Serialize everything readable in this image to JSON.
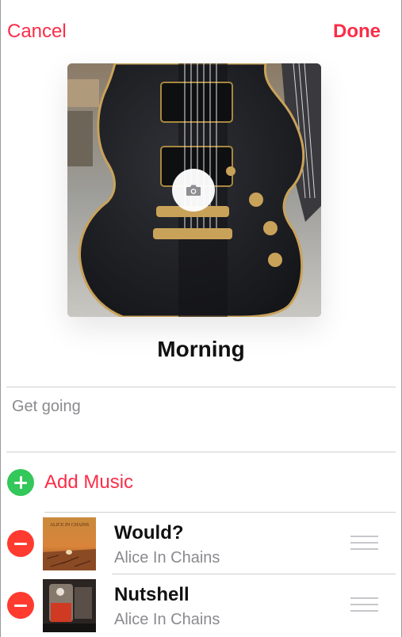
{
  "header": {
    "cancel_label": "Cancel",
    "done_label": "Done"
  },
  "playlist": {
    "title": "Morning",
    "description": "Get going"
  },
  "add_music": {
    "label": "Add Music",
    "icon": "plus-icon"
  },
  "tracks": [
    {
      "title": "Would?",
      "artist": "Alice In Chains",
      "art_text": "ALICE IN CHAINS"
    },
    {
      "title": "Nutshell",
      "artist": "Alice In Chains"
    }
  ],
  "colors": {
    "accent": "#fa2d48",
    "add": "#34c759",
    "remove": "#ff3b30",
    "secondary_text": "#8a8a8f"
  }
}
